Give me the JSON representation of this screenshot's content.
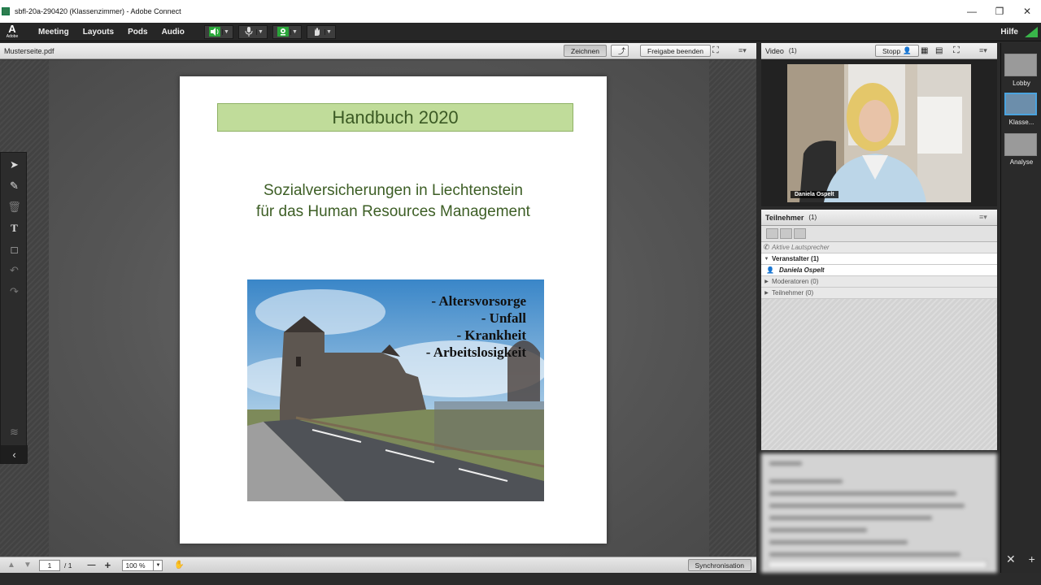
{
  "window": {
    "title": "sbfl-20a-290420 (Klassenzimmer) - Adobe Connect"
  },
  "menubar": {
    "logo_main": "A",
    "logo_sub": "Adobe",
    "items": [
      "Meeting",
      "Layouts",
      "Pods",
      "Audio"
    ],
    "help": "Hilfe"
  },
  "share_pod": {
    "title": "Musterseite.pdf",
    "draw_button": "Zeichnen",
    "stop_share_button": "Freigabe beenden",
    "document": {
      "heading": "Handbuch 2020",
      "subtitle_line1": "Sozialversicherungen in Liechtenstein",
      "subtitle_line2": "für das Human Resources Management",
      "bullets": [
        "- Altersvorsorge",
        "- Unfall",
        "- Krankheit",
        "- Arbeitslosigkeit"
      ]
    },
    "footer": {
      "page_current": "1",
      "page_total": "/ 1",
      "zoom": "100 %",
      "sync_button": "Synchronisation"
    }
  },
  "video_pod": {
    "title": "Video",
    "count": "(1)",
    "stop_button": "Stopp",
    "presenter_name": "Daniela Ospelt"
  },
  "attendees_pod": {
    "title": "Teilnehmer",
    "count": "(1)",
    "active_speakers": "Aktive Lautsprecher",
    "groups": [
      {
        "label": "Veranstalter (1)",
        "expanded": true
      },
      {
        "label": "Moderatoren (0)",
        "expanded": false
      },
      {
        "label": "Teilnehmer (0)",
        "expanded": false
      }
    ],
    "host_name": "Daniela Ospelt"
  },
  "layouts": [
    {
      "label": "Lobby",
      "active": false
    },
    {
      "label": "Klasse...",
      "active": true
    },
    {
      "label": "Analyse",
      "active": false
    }
  ],
  "colors": {
    "accent_green": "#4caf50",
    "header_green": "#c0dc9a",
    "layout_active": "#4aa3df"
  }
}
